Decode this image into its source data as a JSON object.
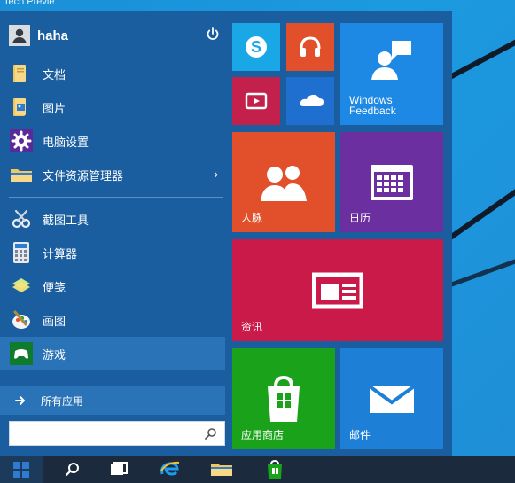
{
  "window": {
    "partial_title": "Tech Previe"
  },
  "user": {
    "name": "haha"
  },
  "left_menu": {
    "items": [
      {
        "label": "文档",
        "icon": "folder-documents-icon"
      },
      {
        "label": "图片",
        "icon": "folder-pictures-icon"
      },
      {
        "label": "电脑设置",
        "icon": "gear-settings-icon"
      },
      {
        "label": "文件资源管理器",
        "icon": "file-explorer-icon",
        "has_submenu": true
      },
      {
        "label": "截图工具",
        "icon": "snipping-tool-icon"
      },
      {
        "label": "计算器",
        "icon": "calculator-icon"
      },
      {
        "label": "便笺",
        "icon": "sticky-notes-icon"
      },
      {
        "label": "画图",
        "icon": "paint-icon"
      },
      {
        "label": "游戏",
        "icon": "games-icon",
        "active": true
      }
    ],
    "all_apps_label": "所有应用",
    "search_placeholder": ""
  },
  "tiles": [
    {
      "id": "skype",
      "label": "",
      "color": "#19a7e6",
      "icon": "skype-icon"
    },
    {
      "id": "music",
      "label": "",
      "color": "#e14f2b",
      "icon": "headphones-icon"
    },
    {
      "id": "video",
      "label": "",
      "color": "#c3204b",
      "icon": "video-icon"
    },
    {
      "id": "onedrive",
      "label": "",
      "color": "#1f6fd1",
      "icon": "onedrive-cloud-icon"
    },
    {
      "id": "windows-feedback",
      "label": "Windows\nFeedback",
      "color": "#1e88e5",
      "icon": "feedback-person-icon"
    },
    {
      "id": "people",
      "label": "人脉",
      "color": "#e14f2b",
      "icon": "people-icon"
    },
    {
      "id": "calendar",
      "label": "日历",
      "color": "#6b2fa0",
      "icon": "calendar-icon"
    },
    {
      "id": "news",
      "label": "资讯",
      "color": "#c91a4a",
      "icon": "news-icon"
    },
    {
      "id": "store",
      "label": "应用商店",
      "color": "#1aa31a",
      "icon": "store-bag-icon"
    },
    {
      "id": "mail",
      "label": "邮件",
      "color": "#1d7fd6",
      "icon": "mail-icon"
    }
  ],
  "taskbar": {
    "items": [
      {
        "icon": "windows-logo-icon"
      },
      {
        "icon": "search-icon"
      },
      {
        "icon": "task-view-icon"
      },
      {
        "icon": "internet-explorer-icon"
      },
      {
        "icon": "file-explorer-icon"
      },
      {
        "icon": "store-bag-icon"
      }
    ]
  }
}
